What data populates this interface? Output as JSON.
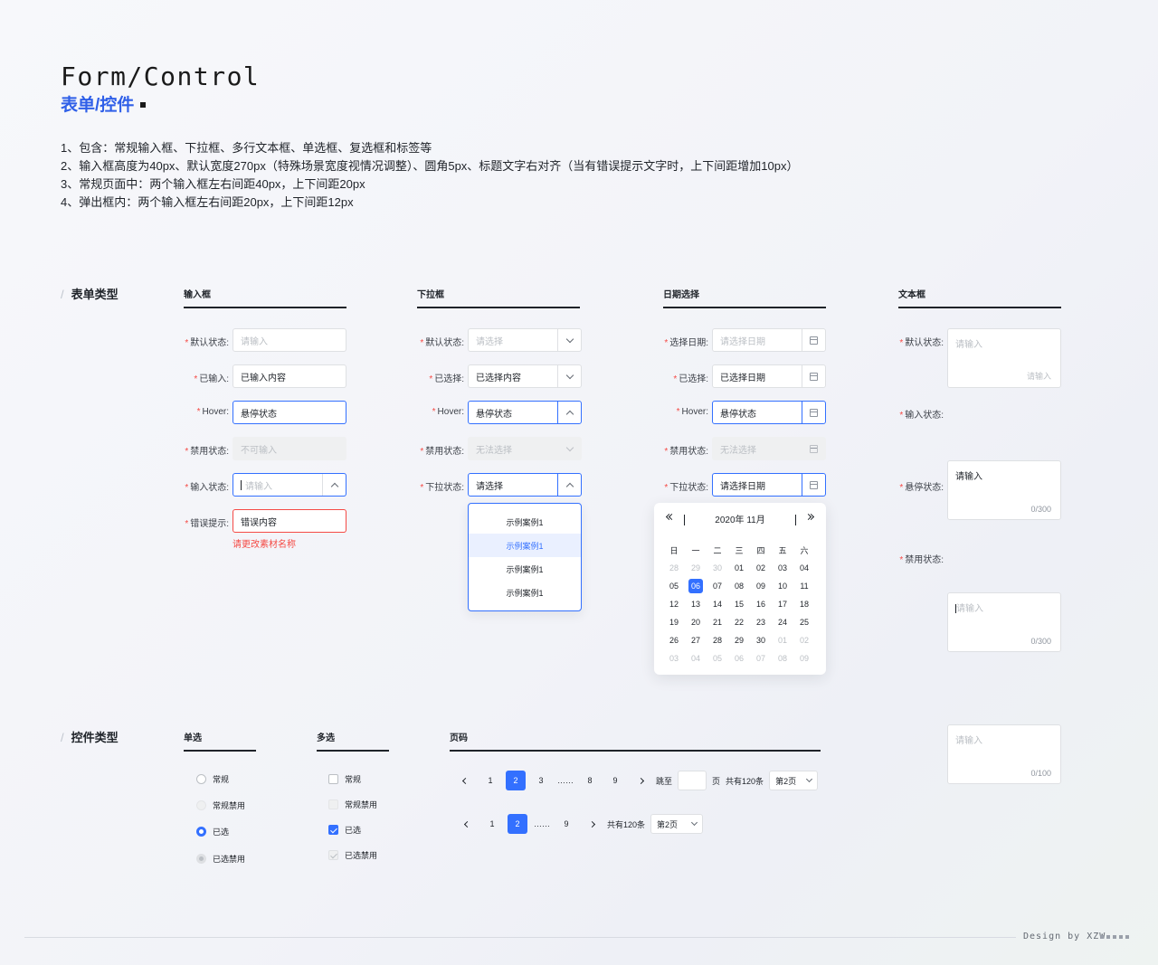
{
  "header": {
    "title_en": "Form/Control",
    "title_cn": "表单/控件",
    "notes": [
      "1、包含：常规输入框、下拉框、多行文本框、单选框、复选框和标签等",
      "2、输入框高度为40px、默认宽度270px（特殊场景宽度视情况调整）、圆角5px、标题文字右对齐（当有错误提示文字时，上下间距增加10px）",
      "3、常规页面中：两个输入框左右间距40px，上下间距20px",
      "4、弹出框内：两个输入框左右间距20px，上下间距12px"
    ]
  },
  "form_section": {
    "label": "表单类型",
    "input": {
      "title": "输入框",
      "rows": [
        {
          "label": "默认状态:",
          "value": "请输入"
        },
        {
          "label": "已输入:",
          "value": "已输入内容"
        },
        {
          "label": "Hover:",
          "value": "悬停状态"
        },
        {
          "label": "禁用状态:",
          "value": "不可输入"
        },
        {
          "label": "输入状态:",
          "value": "请输入"
        },
        {
          "label": "错误提示:",
          "value": "错误内容"
        }
      ],
      "error_message": "请更改素材名称"
    },
    "select": {
      "title": "下拉框",
      "rows": [
        {
          "label": "默认状态:",
          "value": "请选择"
        },
        {
          "label": "已选择:",
          "value": "已选择内容"
        },
        {
          "label": "Hover:",
          "value": "悬停状态"
        },
        {
          "label": "禁用状态:",
          "value": "无法选择"
        },
        {
          "label": "下拉状态:",
          "value": "请选择"
        }
      ],
      "options": [
        "示例案例1",
        "示例案例1",
        "示例案例1",
        "示例案例1"
      ]
    },
    "date": {
      "title": "日期选择",
      "rows": [
        {
          "label": "选择日期:",
          "value": "请选择日期"
        },
        {
          "label": "已选择:",
          "value": "已选择日期"
        },
        {
          "label": "Hover:",
          "value": "悬停状态"
        },
        {
          "label": "禁用状态:",
          "value": "无法选择"
        },
        {
          "label": "下拉状态:",
          "value": "请选择日期"
        }
      ],
      "calendar": {
        "month_label": "2020年 11月",
        "weekdays": [
          "日",
          "一",
          "二",
          "三",
          "四",
          "五",
          "六"
        ],
        "days": [
          {
            "d": "28",
            "muted": true
          },
          {
            "d": "29",
            "muted": true
          },
          {
            "d": "30",
            "muted": true
          },
          {
            "d": "01"
          },
          {
            "d": "02"
          },
          {
            "d": "03"
          },
          {
            "d": "04"
          },
          {
            "d": "05"
          },
          {
            "d": "06",
            "selected": true
          },
          {
            "d": "07"
          },
          {
            "d": "08"
          },
          {
            "d": "09"
          },
          {
            "d": "10"
          },
          {
            "d": "11"
          },
          {
            "d": "12"
          },
          {
            "d": "13"
          },
          {
            "d": "14"
          },
          {
            "d": "15"
          },
          {
            "d": "16"
          },
          {
            "d": "17"
          },
          {
            "d": "18"
          },
          {
            "d": "19"
          },
          {
            "d": "20"
          },
          {
            "d": "21"
          },
          {
            "d": "22"
          },
          {
            "d": "23"
          },
          {
            "d": "24"
          },
          {
            "d": "25"
          },
          {
            "d": "26"
          },
          {
            "d": "27"
          },
          {
            "d": "28"
          },
          {
            "d": "29"
          },
          {
            "d": "30"
          },
          {
            "d": "01",
            "muted": true
          },
          {
            "d": "02",
            "muted": true
          },
          {
            "d": "03",
            "muted": true
          },
          {
            "d": "04",
            "muted": true
          },
          {
            "d": "05",
            "muted": true
          },
          {
            "d": "06",
            "muted": true
          },
          {
            "d": "07",
            "muted": true
          },
          {
            "d": "08",
            "muted": true
          },
          {
            "d": "09",
            "muted": true
          }
        ]
      }
    },
    "textarea": {
      "title": "文本框",
      "rows": [
        {
          "label": "默认状态:",
          "placeholder": "请输入",
          "count": "请输入"
        },
        {
          "label": "输入状态:",
          "placeholder": "请输入",
          "count": "0/300"
        },
        {
          "label": "悬停状态:",
          "placeholder": "请输入",
          "count": "0/300"
        },
        {
          "label": "禁用状态:",
          "placeholder": "请输入",
          "count": "0/100"
        }
      ]
    }
  },
  "control_section": {
    "label": "控件类型",
    "radio": {
      "title": "单选",
      "items": [
        "常规",
        "常规禁用",
        "已选",
        "已选禁用"
      ]
    },
    "checkbox": {
      "title": "多选",
      "items": [
        "常规",
        "常规禁用",
        "已选",
        "已选禁用"
      ]
    },
    "pagination": {
      "title": "页码",
      "row1": {
        "pages": [
          "1",
          "2",
          "3",
          "……",
          "8",
          "9"
        ],
        "active": "2",
        "jump_label": "跳至",
        "page_unit": "页",
        "total": "共有120条",
        "page_select": "第2页"
      },
      "row2": {
        "pages": [
          "1",
          "2",
          "……",
          "9"
        ],
        "active": "2",
        "total": "共有120条",
        "page_select": "第2页"
      }
    }
  },
  "footer": {
    "credit": "Design by XZW"
  },
  "colors": {
    "accent": "#3370ff",
    "title_blue": "#2f5fe8",
    "error": "#f54a45"
  }
}
